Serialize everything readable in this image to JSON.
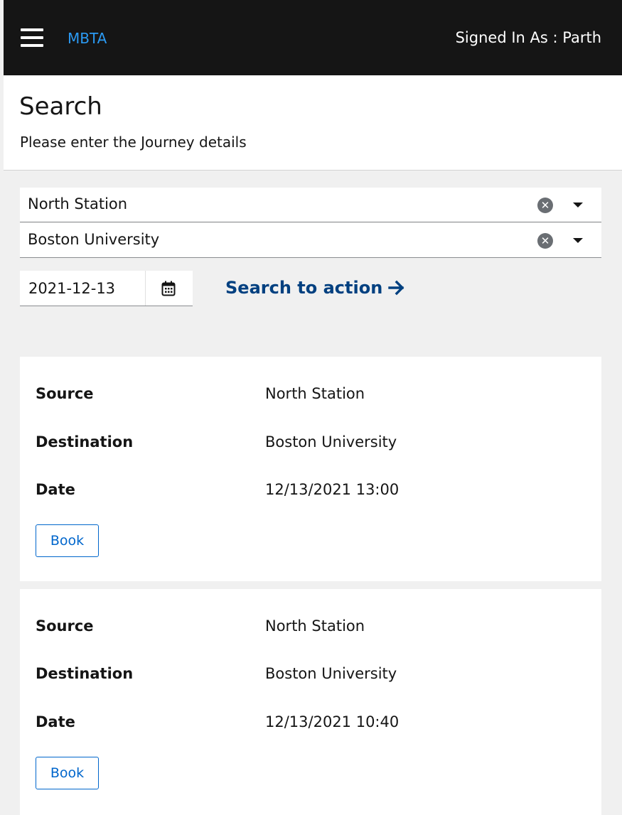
{
  "header": {
    "brand": "MBTA",
    "signed_in": "Signed In As : Parth"
  },
  "page": {
    "title": "Search",
    "subtitle": "Please enter the Journey details"
  },
  "search": {
    "source": "North Station",
    "destination": "Boston University",
    "date": "2021-12-13",
    "action_label": "Search to action",
    "clear_glyph": "✕"
  },
  "labels": {
    "source": "Source",
    "destination": "Destination",
    "date": "Date"
  },
  "results": [
    {
      "source": "North Station",
      "destination": "Boston University",
      "date": "12/13/2021 13:00",
      "book_label": "Book"
    },
    {
      "source": "North Station",
      "destination": "Boston University",
      "date": "12/13/2021 10:40",
      "book_label": "Book"
    }
  ],
  "icons": {
    "menu": "hamburger-icon",
    "clear": "circle-x-icon",
    "dropdown": "caret-down-icon",
    "calendar": "calendar-icon",
    "arrow": "arrow-right-icon"
  },
  "colors": {
    "header_bg": "#151515",
    "brand": "#2b9af3",
    "link": "#004080",
    "button": "#0066cc"
  }
}
